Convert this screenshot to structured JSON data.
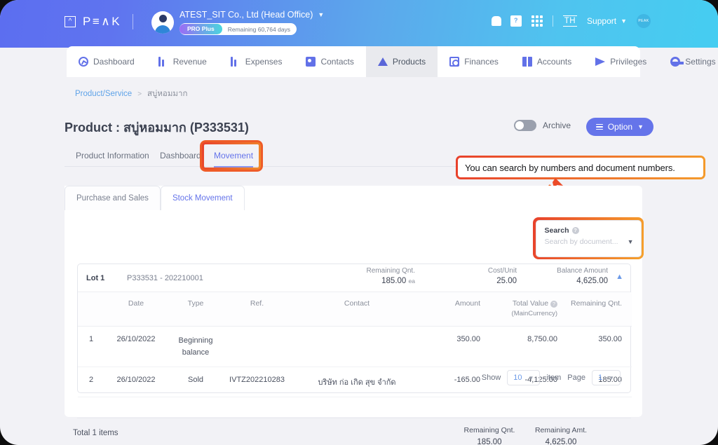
{
  "header": {
    "logo_text": "PEAK",
    "company": "ATEST_SIT Co., Ltd (Head Office)",
    "plan_badge": "PRO Plus",
    "plan_remaining": "Remaining 60,764 days",
    "user_initials": "TH",
    "support_label": "Support",
    "peak_mini": "PEAK",
    "icons": [
      "bell-icon",
      "book-icon",
      "apps-grid-icon"
    ]
  },
  "nav": {
    "items": [
      {
        "label": "Dashboard",
        "icon": "dashboard-icon",
        "active": false
      },
      {
        "label": "Revenue",
        "icon": "revenue-icon",
        "active": false
      },
      {
        "label": "Expenses",
        "icon": "expenses-icon",
        "active": false
      },
      {
        "label": "Contacts",
        "icon": "contacts-icon",
        "active": false
      },
      {
        "label": "Products",
        "icon": "products-icon",
        "active": true
      },
      {
        "label": "Finances",
        "icon": "finances-icon",
        "active": false
      },
      {
        "label": "Accounts",
        "icon": "accounts-icon",
        "active": false
      },
      {
        "label": "Privileges",
        "icon": "privileges-icon",
        "active": false
      },
      {
        "label": "Settings",
        "icon": "settings-gear-icon",
        "active": false
      }
    ]
  },
  "breadcrumb": {
    "root": "Product/Service",
    "separator": ">",
    "current": "สบู่หอมมาก"
  },
  "page": {
    "title": "Product : สบู่หอมมาก (P333531)",
    "archive_label": "Archive",
    "option_label": "Option"
  },
  "tabs": [
    {
      "label": "Product Information",
      "active": false
    },
    {
      "label": "Dashboard",
      "active": false
    },
    {
      "label": "Movement",
      "active": true
    }
  ],
  "callout": {
    "text": "You can search by numbers and document numbers."
  },
  "subtabs": [
    {
      "label": "Purchase and Sales",
      "active": false
    },
    {
      "label": "Stock Movement",
      "active": true
    }
  ],
  "search": {
    "label": "Search",
    "help_icon": "question-mark-icon",
    "placeholder": "Search by document...",
    "value": ""
  },
  "lot": {
    "name": "Lot 1",
    "code": "P333531 - 202210001",
    "metrics": [
      {
        "label": "Remaining Qnt.",
        "value": "185.00",
        "unit": "ea"
      },
      {
        "label": "Cost/Unit",
        "value": "25.00",
        "unit": ""
      },
      {
        "label": "Balance Amount",
        "value": "4,625.00",
        "unit": ""
      }
    ],
    "collapse_icon": "chevron-up-icon"
  },
  "table": {
    "columns": [
      "",
      "Date",
      "Type",
      "Ref.",
      "Contact",
      "Amount",
      "Total Value",
      "Remaining Qnt."
    ],
    "total_value_sub": "(MainCurrency)",
    "total_value_help_icon": "question-mark-icon",
    "rows": [
      {
        "no": "1",
        "date": "26/10/2022",
        "type": "Beginning balance",
        "ref": "",
        "contact": "",
        "amount": "350.00",
        "amount_sign": "positive",
        "total_value": "8,750.00",
        "remaining_qnt": "350.00"
      },
      {
        "no": "2",
        "date": "26/10/2022",
        "type": "Sold",
        "ref": "IVTZ202210283",
        "contact": "บริษัท ก่อ เกิด สุข จำกัด",
        "amount": "-165.00",
        "amount_sign": "negative",
        "total_value": "-4,125.00",
        "remaining_qnt": "185.00"
      }
    ]
  },
  "pagination": {
    "show_label": "Show",
    "show_value": "10",
    "item_label": "item",
    "page_label": "Page",
    "page_value": "1"
  },
  "totals": {
    "label": "Total 1 items",
    "columns": [
      {
        "label": "Remaining Qnt.",
        "value": "185.00"
      },
      {
        "label": "Remaining Amt.",
        "value": "4,625.00"
      }
    ]
  },
  "colors": {
    "brand_purple": "#6574ea",
    "accent_blue": "#5fa3e8",
    "highlight_orange_start": "#e8412c",
    "highlight_orange_end": "#f6a12b",
    "positive_green": "#3fb984",
    "negative_red": "#ef6254"
  }
}
